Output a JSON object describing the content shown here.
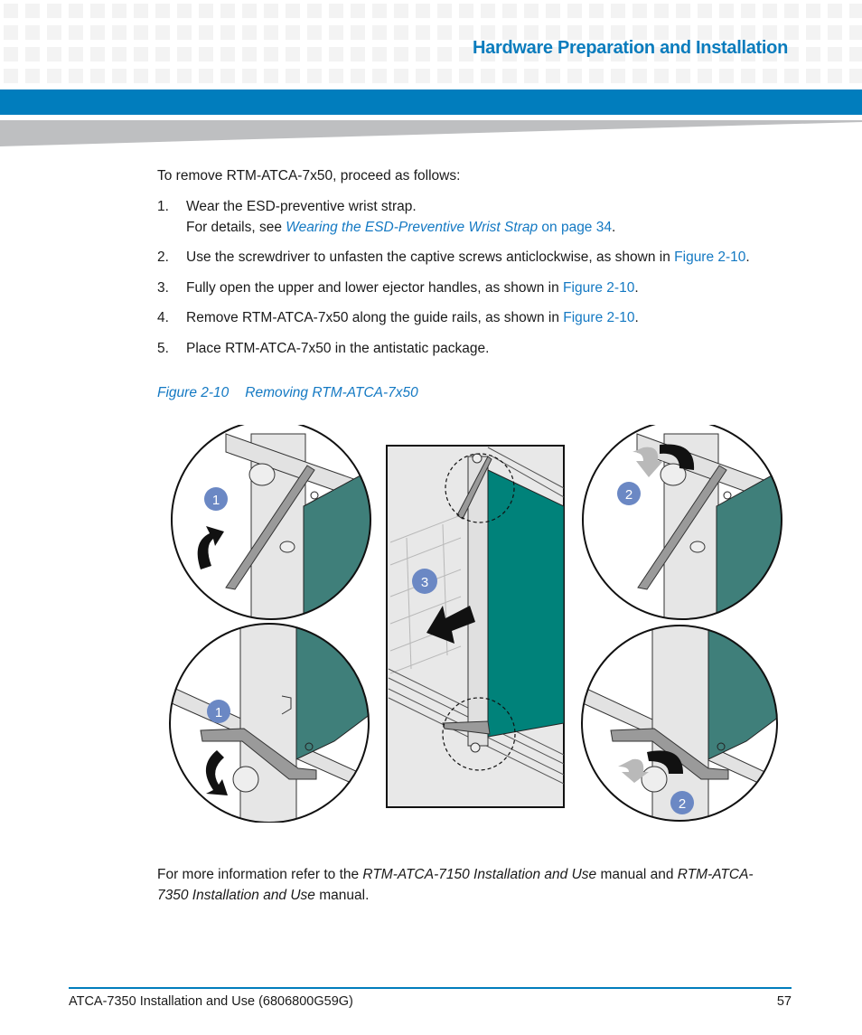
{
  "header": {
    "section_title": "Hardware Preparation and Installation",
    "accent_color": "#017dbd"
  },
  "intro": "To remove RTM-ATCA-7x50, proceed as follows:",
  "steps": [
    {
      "number": "1.",
      "text": "Wear the ESD-preventive wrist strap.",
      "detail_prefix": "For details, see ",
      "detail_link": "Wearing the ESD-Preventive Wrist Strap",
      "detail_page_link": " on page 34",
      "detail_suffix": "."
    },
    {
      "number": "2.",
      "text": "Use the screwdriver to unfasten the captive screws anticlockwise, as shown in ",
      "link": "Figure 2-10",
      "suffix": "."
    },
    {
      "number": "3.",
      "text": "Fully open the upper and lower ejector handles, as shown in ",
      "link": "Figure 2-10",
      "suffix": "."
    },
    {
      "number": "4.",
      "text": "Remove RTM-ATCA-7x50 along the guide rails, as shown in ",
      "link": "Figure 2-10",
      "suffix": "."
    },
    {
      "number": "5.",
      "text": "Place RTM-ATCA-7x50 in the antistatic package."
    }
  ],
  "figure": {
    "label": "Figure 2-10",
    "title": "Removing RTM-ATCA-7x50",
    "callouts": {
      "top_left": "1",
      "top_right": "2",
      "center": "3",
      "bottom_left": "1",
      "bottom_right": "2"
    },
    "colors": {
      "board_teal": "#3f7f7a",
      "board_teal_center": "#00827a",
      "badge": "#6b88c4"
    }
  },
  "more_info": {
    "prefix": "For more information refer to the ",
    "doc1": "RTM-ATCA-7150 Installation and Use",
    "middle": " manual and ",
    "doc2_part1": "RTM-ATCA-",
    "doc2_part2": "7350 Installation and Use",
    "suffix": " manual."
  },
  "footer": {
    "doc_title": "ATCA-7350 Installation and Use (6806800G59G)",
    "page_number": "57"
  }
}
